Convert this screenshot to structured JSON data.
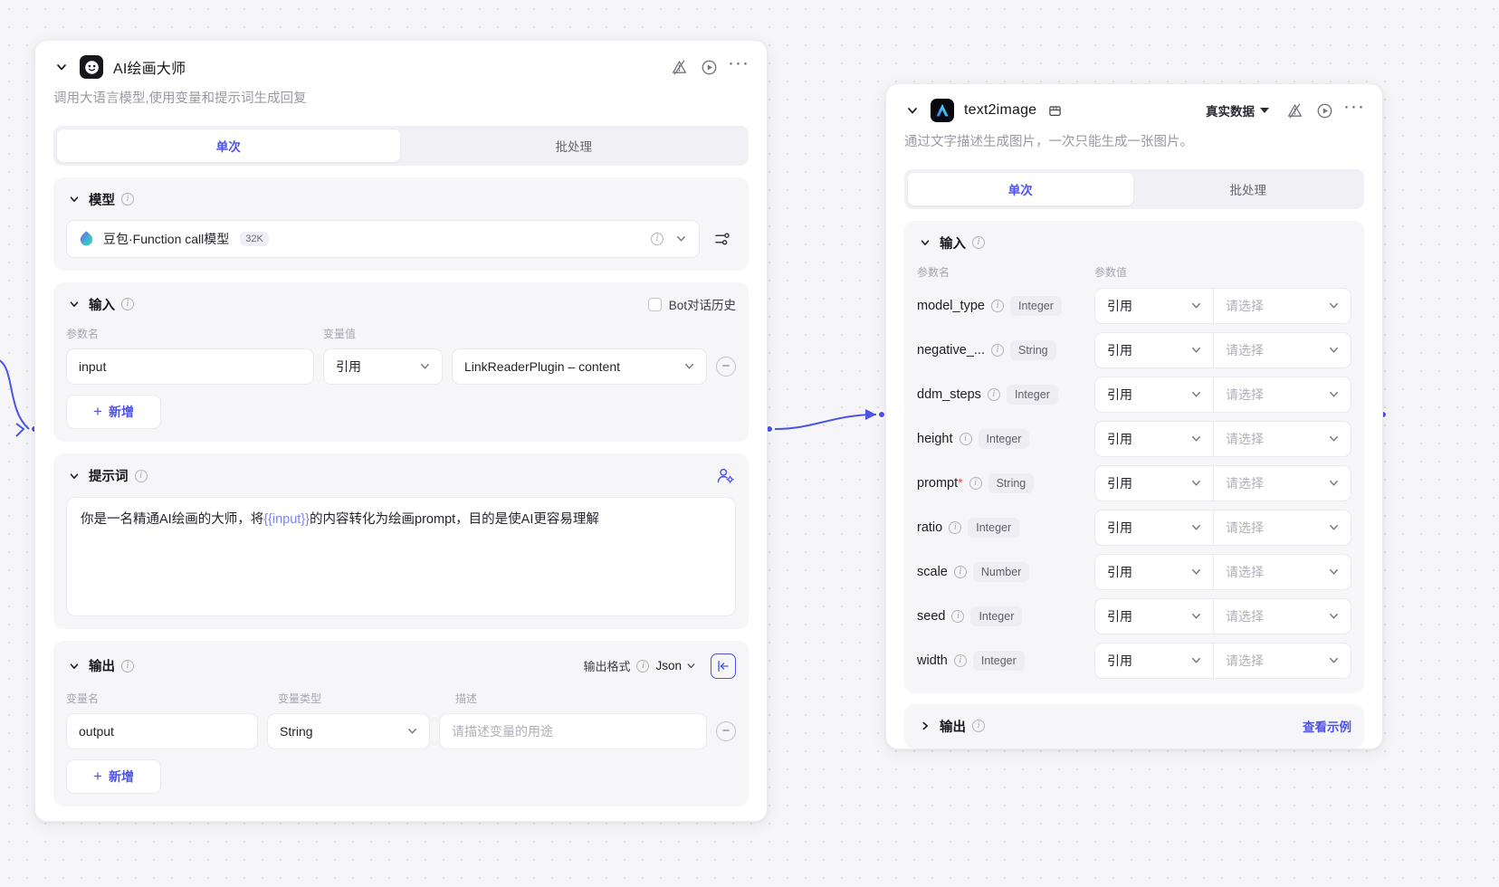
{
  "llm_node": {
    "title": "AI绘画大师",
    "description": "调用大语言模型,使用变量和提示词生成回复",
    "icons": {
      "warning": "warning-off-icon",
      "run": "run-icon",
      "more": "more-icon"
    },
    "tabs": [
      {
        "label": "单次",
        "active": true
      },
      {
        "label": "批处理",
        "active": false
      }
    ],
    "model_section": {
      "title": "模型",
      "model_name": "豆包·Function call模型",
      "context_badge": "32K"
    },
    "input_section": {
      "title": "输入",
      "bot_history_label": "Bot对话历史",
      "col_param_name": "参数名",
      "col_var_value": "变量值",
      "rows": [
        {
          "name": "input",
          "mode": "引用",
          "value": "LinkReaderPlugin – content"
        }
      ],
      "add_label": "新增"
    },
    "prompt_section": {
      "title": "提示词",
      "text_before": "你是一名精通AI绘画的大师，将",
      "token": "{{input}}",
      "text_after": "的内容转化为绘画prompt，目的是使AI更容易理解"
    },
    "output_section": {
      "title": "输出",
      "format_label": "输出格式",
      "format_value": "Json",
      "col_var_name": "变量名",
      "col_var_type": "变量类型",
      "col_desc": "描述",
      "rows": [
        {
          "name": "output",
          "type": "String",
          "desc_placeholder": "请描述变量的用途"
        }
      ],
      "add_label": "新增"
    }
  },
  "t2i_node": {
    "title": "text2image",
    "description": "通过文字描述生成图片，一次只能生成一张图片。",
    "data_mode": "真实数据",
    "tabs": [
      {
        "label": "单次",
        "active": true
      },
      {
        "label": "批处理",
        "active": false
      }
    ],
    "input_section": {
      "title": "输入",
      "col_param_name": "参数名",
      "col_param_value": "参数值",
      "default_mode": "引用",
      "value_placeholder": "请选择",
      "params": [
        {
          "name": "model_type",
          "required": false,
          "type": "Integer"
        },
        {
          "name": "negative_...",
          "required": false,
          "type": "String"
        },
        {
          "name": "ddm_steps",
          "required": false,
          "type": "Integer"
        },
        {
          "name": "height",
          "required": false,
          "type": "Integer"
        },
        {
          "name": "prompt",
          "required": true,
          "type": "String"
        },
        {
          "name": "ratio",
          "required": false,
          "type": "Integer"
        },
        {
          "name": "scale",
          "required": false,
          "type": "Number"
        },
        {
          "name": "seed",
          "required": false,
          "type": "Integer"
        },
        {
          "name": "width",
          "required": false,
          "type": "Integer"
        }
      ]
    },
    "output_section": {
      "title": "输出",
      "view_example": "查看示例"
    }
  },
  "colors": {
    "accent": "#4d53e8",
    "token": "#7f85f2",
    "required": "#f03f40",
    "canvas": "#f6f6f9"
  }
}
